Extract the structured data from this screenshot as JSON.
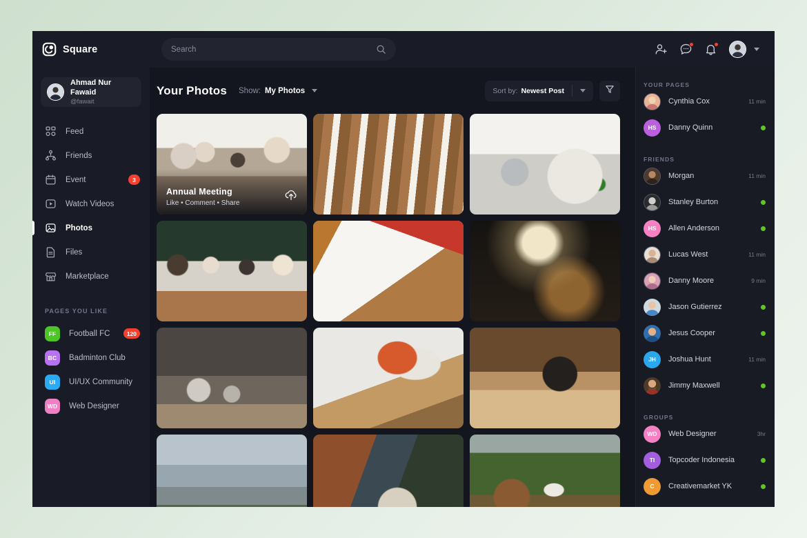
{
  "colors": {
    "page_background": "#d5e4d5",
    "window_background": "#14161f",
    "panel_background": "#191c26",
    "accent_red": "#f4402f",
    "online_green": "#5fc721",
    "text_primary": "#ffffff",
    "text_muted": "#8b90a2"
  },
  "topbar": {
    "brand": "Square",
    "logo_icon": "square-logo-icon",
    "search": {
      "placeholder": "Search",
      "value": "",
      "icon": "search-icon"
    },
    "icons": [
      {
        "name": "add-friend-icon",
        "badge": false
      },
      {
        "name": "messages-icon",
        "badge": true
      },
      {
        "name": "notifications-bell-icon",
        "badge": true
      }
    ],
    "avatar_caret_icon": "chevron-down-icon"
  },
  "sidebar": {
    "profile": {
      "name": "Ahmad Nur Fawaid",
      "handle": "@fawait"
    },
    "nav": [
      {
        "label": "Feed",
        "icon": "feed-icon",
        "active": false,
        "badge": ""
      },
      {
        "label": "Friends",
        "icon": "friends-icon",
        "active": false,
        "badge": ""
      },
      {
        "label": "Event",
        "icon": "calendar-icon",
        "active": false,
        "badge": "3"
      },
      {
        "label": "Watch Videos",
        "icon": "video-play-icon",
        "active": false,
        "badge": ""
      },
      {
        "label": "Photos",
        "icon": "photo-icon",
        "active": true,
        "badge": ""
      },
      {
        "label": "Files",
        "icon": "file-icon",
        "active": false,
        "badge": ""
      },
      {
        "label": "Marketplace",
        "icon": "store-icon",
        "active": false,
        "badge": ""
      }
    ],
    "pages_heading": "PAGES YOU LIKE",
    "pages": [
      {
        "label": "Football FC",
        "initials": "FF",
        "color": "#4ec526",
        "badge": "120"
      },
      {
        "label": "Badminton Club",
        "initials": "BC",
        "color": "#b871f0",
        "badge": ""
      },
      {
        "label": "UI/UX Community",
        "initials": "UI",
        "color": "#2aaaf2",
        "badge": ""
      },
      {
        "label": "Web Designer",
        "initials": "WD",
        "color": "#f07fc4",
        "badge": ""
      }
    ]
  },
  "main": {
    "title": "Your Photos",
    "show": {
      "label": "Show:",
      "value": "My Photos"
    },
    "sort": {
      "label": "Sort by:",
      "value": "Newest Post"
    },
    "filter_icon": "filter-icon",
    "photos": [
      {
        "alt": "annual-meeting-conference-room",
        "title": "Annual Meeting",
        "actions": "Like • Comment • Share",
        "icon": "upload-cloud-icon",
        "has_overlay": true
      },
      {
        "alt": "banquet-hall-chairs-decor",
        "has_overlay": false
      },
      {
        "alt": "paint-palette-hands-craft",
        "has_overlay": false
      },
      {
        "alt": "team-meeting-cafe-laptop",
        "has_overlay": false
      },
      {
        "alt": "blueprint-drill-tools-desk",
        "has_overlay": false
      },
      {
        "alt": "workshop-lamp-machinery-dark",
        "has_overlay": false
      },
      {
        "alt": "garage-workbench-tools",
        "has_overlay": false
      },
      {
        "alt": "carpenter-gloves-measuring-wood",
        "has_overlay": false
      },
      {
        "alt": "vintage-motorcycle-barn-garage",
        "has_overlay": false
      },
      {
        "alt": "mountain-lake-landscape",
        "has_overlay": false
      },
      {
        "alt": "pottery-wheel-hands-clay",
        "has_overlay": false
      },
      {
        "alt": "woman-white-dress-junkyard-greenery",
        "has_overlay": false
      }
    ]
  },
  "right_sidebar": {
    "sections": [
      {
        "heading": "YOUR PAGES",
        "items": [
          {
            "name": "Cynthia Cox",
            "time": "11 min",
            "online": false,
            "avatar_type": "photo",
            "photo": "blonde-woman",
            "ring": true
          },
          {
            "name": "Danny Quinn",
            "time": "",
            "online": true,
            "avatar_type": "initials",
            "initials": "HS",
            "color": "#bb5ee0"
          }
        ]
      },
      {
        "heading": "FRIENDS",
        "items": [
          {
            "name": "Morgan",
            "time": "11 min",
            "online": false,
            "avatar_type": "photo",
            "photo": "dark-portrait",
            "ring": true
          },
          {
            "name": "Stanley Burton",
            "time": "",
            "online": true,
            "avatar_type": "photo",
            "photo": "bw-portrait",
            "ring": true
          },
          {
            "name": "Allen Anderson",
            "time": "",
            "online": true,
            "avatar_type": "initials",
            "initials": "HS",
            "color": "#f780c4"
          },
          {
            "name": "Lucas West",
            "time": "11 min",
            "online": false,
            "avatar_type": "photo",
            "photo": "light-portrait",
            "ring": true
          },
          {
            "name": "Danny Moore",
            "time": "9 min",
            "online": false,
            "avatar_type": "photo",
            "photo": "pink-portrait",
            "ring": true
          },
          {
            "name": "Jason Gutierrez",
            "time": "",
            "online": true,
            "avatar_type": "photo",
            "photo": "kid-portrait",
            "ring": false
          },
          {
            "name": "Jesus Cooper",
            "time": "",
            "online": true,
            "avatar_type": "photo",
            "photo": "blue-portrait",
            "ring": false
          },
          {
            "name": "Joshua Hunt",
            "time": "11 min",
            "online": false,
            "avatar_type": "initials",
            "initials": "JH",
            "color": "#29a8f0"
          },
          {
            "name": "Jimmy Maxwell",
            "time": "",
            "online": true,
            "avatar_type": "photo",
            "photo": "bearded-portrait",
            "ring": false
          }
        ]
      },
      {
        "heading": "GROUPS",
        "items": [
          {
            "name": "Web Designer",
            "time": "3hr",
            "online": false,
            "avatar_type": "initials",
            "initials": "WD",
            "color": "#f780c4"
          },
          {
            "name": "Topcoder Indonesia",
            "time": "",
            "online": true,
            "avatar_type": "initials",
            "initials": "TI",
            "color": "#a35ee0"
          },
          {
            "name": "Creativemarket YK",
            "time": "",
            "online": true,
            "avatar_type": "initials",
            "initials": "C",
            "color": "#f09a33"
          }
        ]
      }
    ]
  }
}
